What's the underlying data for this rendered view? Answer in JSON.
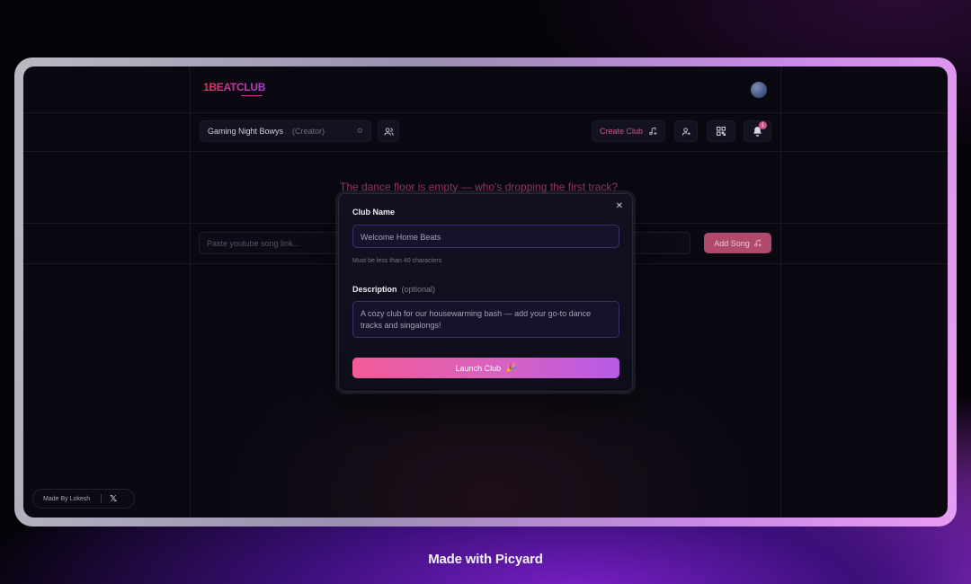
{
  "header": {
    "logo": "1BEATCLUB"
  },
  "toolbar": {
    "club_name": "Gaming Night Bowys",
    "club_role": "(Creator)",
    "create_club_label": "Create Club",
    "notification_count": "1"
  },
  "main": {
    "empty_message": "The dance floor is empty — who's dropping the first track?",
    "song_input_placeholder": "Paste youtube song link...",
    "add_song_label": "Add Song"
  },
  "modal": {
    "club_name_label": "Club Name",
    "club_name_value": "Welcome Home Beats",
    "club_name_hint": "Must be less than 40 characters",
    "description_label": "Description",
    "description_optional": "(optional)",
    "description_value": "A cozy club for our housewarming bash — add your go-to dance tracks and singalongs!",
    "launch_label": "Launch Club"
  },
  "footer": {
    "made_by": "Made By Lokesh",
    "x_icon": "x-logo-icon"
  },
  "watermark": "Made with Picyard",
  "colors": {
    "accent": "#d2508c",
    "gradient_start": "#f25b97",
    "gradient_end": "#b85ae8"
  }
}
